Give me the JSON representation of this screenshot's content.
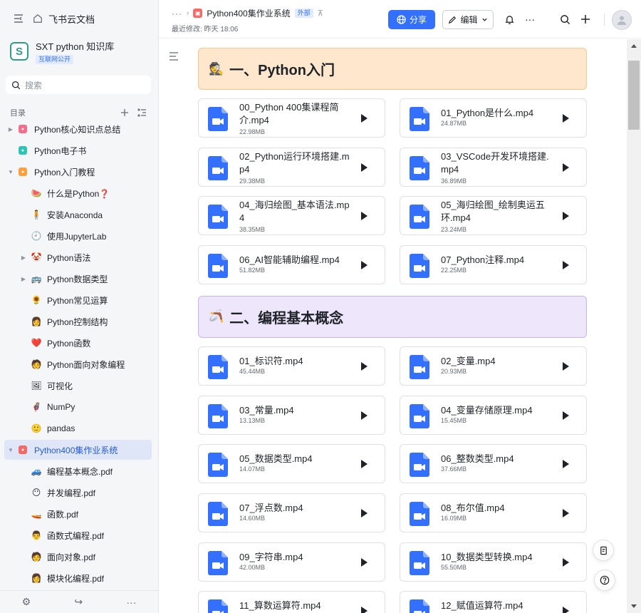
{
  "sidebar": {
    "home_label": "飞书云文档",
    "kb": {
      "title": "SXT python 知识库",
      "badge": "互联网公开",
      "logo_letter": "S"
    },
    "search_placeholder": "搜索",
    "toc_label": "目录",
    "items": [
      {
        "label": "Python核心知识点总结",
        "icon": "bookmark-pink-icon",
        "glyph": "",
        "caret": "right"
      },
      {
        "label": "Python电子书",
        "icon": "tag-teal-icon",
        "glyph": "",
        "caret": ""
      },
      {
        "label": "Python入门教程",
        "icon": "doc-orange-icon",
        "glyph": "",
        "caret": "down"
      },
      {
        "label": "什么是Python❓",
        "icon": "watermelon-icon",
        "glyph": "🍉",
        "caret": ""
      },
      {
        "label": "安装Anaconda",
        "icon": "person-standing-icon",
        "glyph": "🧍",
        "caret": ""
      },
      {
        "label": "使用JupyterLab",
        "icon": "clock-icon",
        "glyph": "🕘",
        "caret": ""
      },
      {
        "label": "Python语法",
        "icon": "clown-face-icon",
        "glyph": "🤡",
        "caret": "right"
      },
      {
        "label": "Python数据类型",
        "icon": "bus-icon",
        "glyph": "🚌",
        "caret": "right"
      },
      {
        "label": "Python常见运算",
        "icon": "flower-icon",
        "glyph": "🌻",
        "caret": ""
      },
      {
        "label": "Python控制结构",
        "icon": "person-desk-icon",
        "glyph": "👩",
        "caret": ""
      },
      {
        "label": "Python函数",
        "icon": "heart-icon",
        "glyph": "❤️",
        "caret": ""
      },
      {
        "label": "Python面向对象编程",
        "icon": "person-laptop-icon",
        "glyph": "🧑",
        "caret": ""
      },
      {
        "label": "可视化",
        "icon": "canvas-icon",
        "glyph": "🖼",
        "caret": ""
      },
      {
        "label": "NumPy",
        "icon": "superhero-icon",
        "glyph": "🦸",
        "caret": ""
      },
      {
        "label": "pandas",
        "icon": "smiley-icon",
        "glyph": "🙂",
        "caret": ""
      },
      {
        "label": "Python400集作业系统",
        "icon": "doc-red-icon",
        "glyph": "",
        "caret": "down",
        "active": true
      },
      {
        "label": "编程基本概念.pdf",
        "icon": "car-icon",
        "glyph": "🚙",
        "caret": ""
      },
      {
        "label": "并发编程.pdf",
        "icon": "face-icon",
        "glyph": "😶",
        "caret": ""
      },
      {
        "label": "函数.pdf",
        "icon": "boat-icon",
        "glyph": "🚤",
        "caret": ""
      },
      {
        "label": "函数式编程.pdf",
        "icon": "person-desk2-icon",
        "glyph": "👨",
        "caret": ""
      },
      {
        "label": "面向对象.pdf",
        "icon": "person-computer-icon",
        "glyph": "🧑",
        "caret": ""
      },
      {
        "label": "模块化编程.pdf",
        "icon": "teacher-icon",
        "glyph": "👩",
        "caret": ""
      }
    ]
  },
  "header": {
    "more_dots": "···",
    "doc_title": "Python400集作业系统",
    "external_badge": "外部",
    "last_edited": "最近修改: 昨天 18:06",
    "share_label": "分享",
    "edit_label": "编辑"
  },
  "sections": [
    {
      "title": "一、Python入门",
      "emoji": "🕵️",
      "color": "orange",
      "files": [
        {
          "name": "00_Python 400集课程简介.mp4",
          "size": "22.98MB"
        },
        {
          "name": "01_Python是什么.mp4",
          "size": "24.87MB"
        },
        {
          "name": "02_Python运行环境搭建.mp4",
          "size": "29.38MB"
        },
        {
          "name": "03_VSCode开发环境搭建.mp4",
          "size": "36.89MB"
        },
        {
          "name": "04_海归绘图_基本语法.mp4",
          "size": "38.35MB"
        },
        {
          "name": "05_海归绘图_绘制奥运五环.mp4",
          "size": "23.24MB"
        },
        {
          "name": "06_AI智能辅助编程.mp4",
          "size": "51.82MB"
        },
        {
          "name": "07_Python注释.mp4",
          "size": "22.25MB"
        }
      ]
    },
    {
      "title": "二、编程基本概念",
      "emoji": "🪃",
      "color": "purple",
      "files": [
        {
          "name": "01_标识符.mp4",
          "size": "45.44MB"
        },
        {
          "name": "02_变量.mp4",
          "size": "20.93MB"
        },
        {
          "name": "03_常量.mp4",
          "size": "13.13MB"
        },
        {
          "name": "04_变量存储原理.mp4",
          "size": "15.45MB"
        },
        {
          "name": "05_数据类型.mp4",
          "size": "14.07MB"
        },
        {
          "name": "06_整数类型.mp4",
          "size": "37.66MB"
        },
        {
          "name": "07_浮点数.mp4",
          "size": "14.60MB"
        },
        {
          "name": "08_布尔值.mp4",
          "size": "16.09MB"
        },
        {
          "name": "09_字符串.mp4",
          "size": "42.00MB"
        },
        {
          "name": "10_数据类型转换.mp4",
          "size": "55.50MB"
        },
        {
          "name": "11_算数运算符.mp4",
          "size": ""
        },
        {
          "name": "12_赋值运算符.mp4",
          "size": ""
        }
      ]
    }
  ],
  "colors": {
    "accent": "#3370ff",
    "file_icon": "#3370ff",
    "active_item_bg": "#dfe6f7"
  }
}
